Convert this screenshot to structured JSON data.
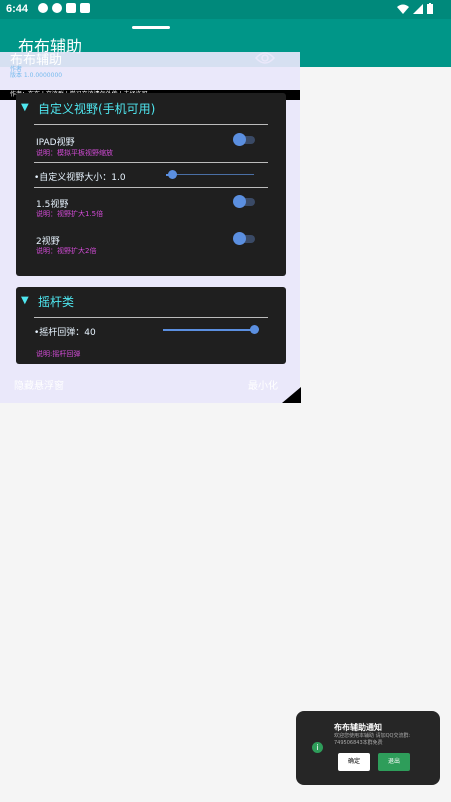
{
  "status_bar": {
    "time": "6:44",
    "signal": "wifi-icon",
    "battery": "battery-icon"
  },
  "app_bar": {
    "title": "布布辅助"
  },
  "overlay": {
    "name": "布布辅助",
    "sub_line1": "作者",
    "sub_line2": "版本 1.0.0000000",
    "author_bar": "作者：布布 | 交流群 | 学习交流请勿外传 | 未经许可",
    "sections": [
      {
        "title": "自定义视野(手机可用)",
        "items": [
          {
            "title": "IPAD视野",
            "desc": "说明：模拟平板视野缩放",
            "toggle_on": true
          },
          {
            "slider_label": "•自定义视野大小：1.0",
            "slider_value": 1.0
          },
          {
            "title": "1.5视野",
            "desc": "说明：视野扩大1.5倍",
            "toggle_on": true
          },
          {
            "title": "2视野",
            "desc": "说明：视野扩大2倍",
            "toggle_on": true
          }
        ]
      },
      {
        "title": "摇杆类",
        "items": [
          {
            "slider_label": "•摇杆回弹：40",
            "slider_value": 40
          },
          {
            "desc": "说明:摇杆回弹"
          }
        ]
      }
    ],
    "bottom_left": "隐藏悬浮窗",
    "bottom_right": "最小化"
  },
  "toast": {
    "title": "布布辅助通知",
    "body": "欢迎您使用本辅助 请加QQ交流群: 749506843本群免费",
    "confirm": "确定",
    "exit": "退出"
  },
  "colors": {
    "accent": "#009688",
    "section_title": "#4fe6ef",
    "desc": "#d24bd6",
    "slider": "#5b8fe0"
  }
}
